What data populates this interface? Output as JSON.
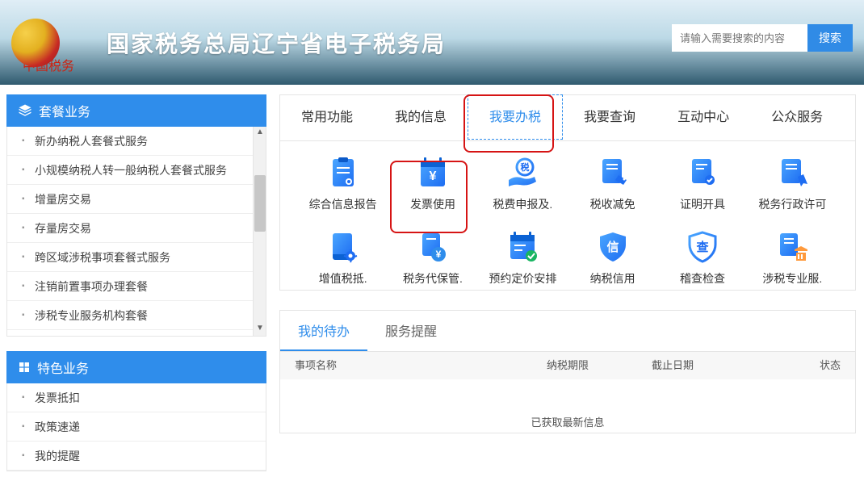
{
  "header": {
    "title": "国家税务总局辽宁省电子税务局"
  },
  "search": {
    "placeholder": "请输入需要搜索的内容",
    "button": "搜索"
  },
  "sidebar1": {
    "title": "套餐业务",
    "items": [
      "新办纳税人套餐式服务",
      "小规模纳税人转一般纳税人套餐式服务",
      "增量房交易",
      "存量房交易",
      "跨区域涉税事项套餐式服务",
      "注销前置事项办理套餐",
      "涉税专业服务机构套餐"
    ]
  },
  "sidebar2": {
    "title": "特色业务",
    "items": [
      "发票抵扣",
      "政策速递",
      "我的提醒"
    ]
  },
  "tabs": [
    "常用功能",
    "我的信息",
    "我要办税",
    "我要查询",
    "互动中心",
    "公众服务"
  ],
  "active_tab": "我要办税",
  "grid_row1": [
    {
      "label": "综合信息报告"
    },
    {
      "label": "发票使用"
    },
    {
      "label": "税费申报及."
    },
    {
      "label": "税收减免"
    },
    {
      "label": "证明开具"
    },
    {
      "label": "税务行政许可"
    }
  ],
  "grid_row2": [
    {
      "label": "增值税抵."
    },
    {
      "label": "税务代保管."
    },
    {
      "label": "预约定价安排"
    },
    {
      "label": "纳税信用"
    },
    {
      "label": "稽查检查"
    },
    {
      "label": "涉税专业服."
    }
  ],
  "lower_tabs": [
    "我的待办",
    "服务提醒"
  ],
  "active_lower_tab": "我的待办",
  "table_headers": {
    "name": "事项名称",
    "d1": "纳税期限",
    "d2": "截止日期",
    "st": "状态"
  },
  "table_msg": "已获取最新信息"
}
